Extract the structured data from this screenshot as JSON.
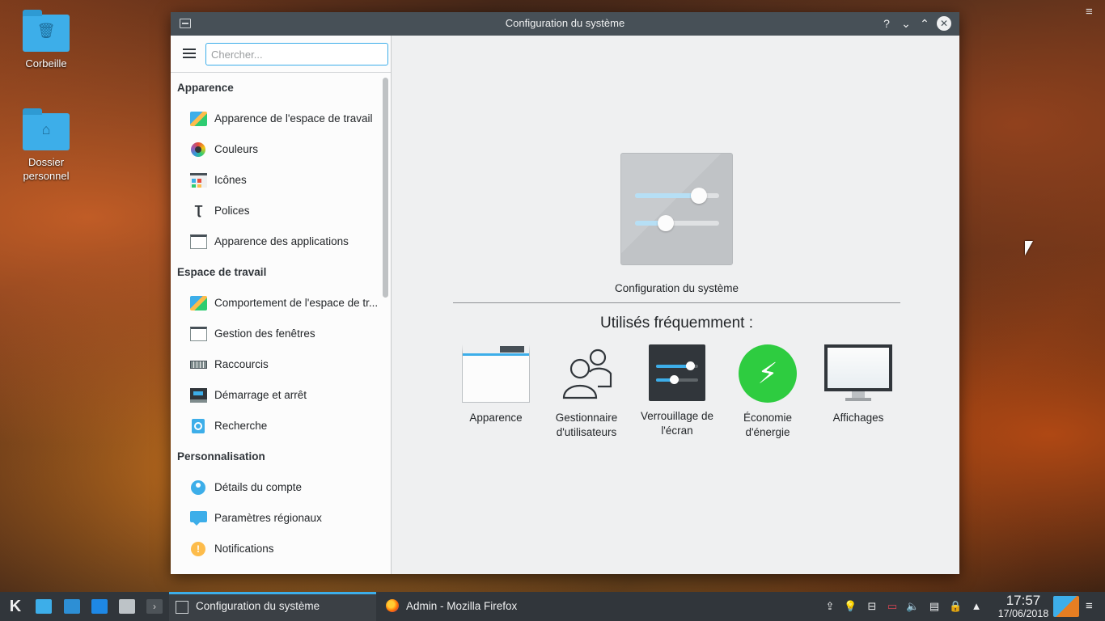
{
  "desktop": {
    "icons": [
      {
        "label": "Corbeille",
        "icon": "trash-icon"
      },
      {
        "label": "Dossier personnel",
        "icon": "home-folder-icon"
      }
    ],
    "menu_icon": "hamburger-icon"
  },
  "window": {
    "title": "Configuration du système",
    "buttons": {
      "help": "?",
      "minimize": "⌄",
      "maximize": "⌃",
      "close": "✕"
    }
  },
  "sidebar": {
    "search_placeholder": "Chercher...",
    "categories": [
      {
        "label": "Apparence",
        "items": [
          {
            "label": "Apparence de l'espace de travail",
            "icon": "workspace-theme-icon"
          },
          {
            "label": "Couleurs",
            "icon": "colors-icon"
          },
          {
            "label": "Icônes",
            "icon": "icons-icon"
          },
          {
            "label": "Polices",
            "icon": "fonts-icon"
          },
          {
            "label": "Apparence des applications",
            "icon": "app-style-icon"
          }
        ]
      },
      {
        "label": "Espace de travail",
        "items": [
          {
            "label": "Comportement de l'espace de tr...",
            "icon": "workspace-behavior-icon"
          },
          {
            "label": "Gestion des fenêtres",
            "icon": "window-management-icon"
          },
          {
            "label": "Raccourcis",
            "icon": "keyboard-icon"
          },
          {
            "label": "Démarrage et arrêt",
            "icon": "startup-icon"
          },
          {
            "label": "Recherche",
            "icon": "search-icon"
          }
        ]
      },
      {
        "label": "Personnalisation",
        "items": [
          {
            "label": "Détails du compte",
            "icon": "account-icon"
          },
          {
            "label": "Paramètres régionaux",
            "icon": "regional-icon"
          },
          {
            "label": "Notifications",
            "icon": "notifications-icon"
          }
        ]
      }
    ]
  },
  "main": {
    "hero_caption": "Configuration du système",
    "frequent_title": "Utilisés fréquemment :",
    "frequent": [
      {
        "label": "Apparence",
        "icon": "appearance-icon"
      },
      {
        "label": "Gestionnaire d'utilisateurs",
        "icon": "users-icon"
      },
      {
        "label": "Verrouillage de l'écran",
        "icon": "screen-lock-icon"
      },
      {
        "label": "Économie d'énergie",
        "icon": "power-icon"
      },
      {
        "label": "Affichages",
        "icon": "display-icon"
      }
    ]
  },
  "taskbar": {
    "tasks": [
      {
        "label": "Configuration du système",
        "active": true
      },
      {
        "label": "Admin - Mozilla Firefox",
        "active": false
      }
    ],
    "clock_time": "17:57",
    "clock_date": "17/06/2018"
  },
  "colors": {
    "accent": "#3daee9",
    "titlebar": "#475057",
    "panel": "#31363b",
    "power": "#2ecc40"
  }
}
